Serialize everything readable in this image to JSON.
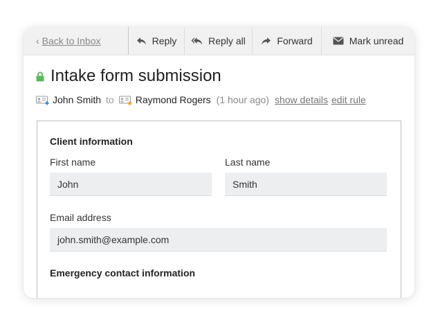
{
  "toolbar": {
    "back_label": "Back to Inbox",
    "reply_label": "Reply",
    "reply_all_label": "Reply all",
    "forward_label": "Forward",
    "mark_unread_label": "Mark unread"
  },
  "message": {
    "subject": "Intake form submission",
    "from_name": "John Smith",
    "to_word": "to",
    "to_name": "Raymond Rogers",
    "time": "(1 hour ago)",
    "show_details_label": "show details",
    "edit_rule_label": "edit rule"
  },
  "form": {
    "section_client": "Client information",
    "first_name_label": "First name",
    "first_name_value": "John",
    "last_name_label": "Last name",
    "last_name_value": "Smith",
    "email_label": "Email address",
    "email_value": "john.smith@example.com",
    "section_emergency": "Emergency contact information"
  },
  "colors": {
    "lock": "#5cb85c",
    "contact_badge_plus": "#3a7bd5",
    "contact_badge_star": "#f0a020",
    "field_bg": "#eceef0"
  },
  "icons": {
    "lock": "lock-icon",
    "reply": "reply-icon",
    "reply_all": "reply-all-icon",
    "forward": "forward-icon",
    "mark_unread": "envelope-icon",
    "sender": "contact-card-add-icon",
    "recipient": "contact-card-star-icon"
  }
}
